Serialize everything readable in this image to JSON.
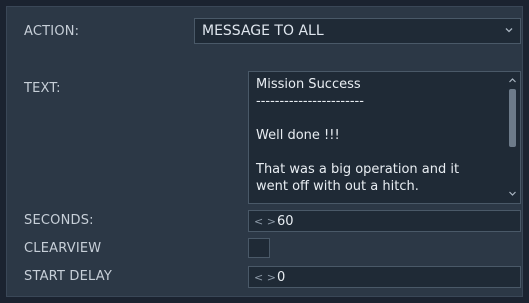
{
  "action": {
    "label": "ACTION:",
    "selected": "MESSAGE TO ALL"
  },
  "text": {
    "label": "TEXT:",
    "lines": [
      "Mission Success",
      "-----------------------",
      "",
      "Well done !!!",
      "",
      "That was a big operation and it",
      "went off with out a hitch."
    ]
  },
  "seconds": {
    "label": "SECONDS:",
    "stepper": "< >",
    "value": "60"
  },
  "clearview": {
    "label": "CLEARVIEW",
    "checked": false
  },
  "start_delay": {
    "label": "START DELAY",
    "stepper": "< >",
    "value": "0"
  },
  "icons": [
    "chevron-down-icon",
    "scroll-up-arrow-icon",
    "scroll-down-arrow-icon"
  ]
}
